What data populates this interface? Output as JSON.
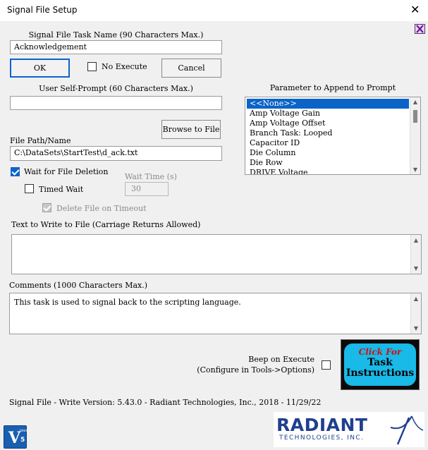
{
  "window": {
    "title": "Signal File Setup",
    "close_glyph": "✕"
  },
  "task_name": {
    "label": "Signal File Task Name (90 Characters Max.)",
    "value": "Acknowledgement"
  },
  "buttons": {
    "ok": "OK",
    "cancel": "Cancel",
    "browse": "Browse to File"
  },
  "no_execute": {
    "label": "No Execute",
    "checked": false
  },
  "self_prompt": {
    "label": "User Self-Prompt (60 Characters Max.)",
    "value": ""
  },
  "parameter": {
    "label": "Parameter to Append to Prompt",
    "items": [
      "<<None>>",
      "Amp Voltage Gain",
      "Amp Voltage Offset",
      "Branch Task: Looped",
      "Capacitor ID",
      "Die Column",
      "Die Row",
      "DRIVE Voltage"
    ],
    "selected": "<<None>>"
  },
  "file_path": {
    "label": "File Path/Name",
    "value": "C:\\DataSets\\StartTest\\d_ack.txt"
  },
  "wait_deletion": {
    "label": "Wait for File Deletion",
    "checked": true
  },
  "timed_wait": {
    "label": "Timed Wait",
    "checked": false
  },
  "wait_time": {
    "label": "Wait Time (s)",
    "value": "30"
  },
  "delete_timeout": {
    "label": "Delete File on Timeout",
    "checked": true,
    "disabled": true
  },
  "text_write": {
    "label": "Text to Write to File (Carriage Returns Allowed)",
    "value": ""
  },
  "comments": {
    "label": "Comments (1000 Characters Max.)",
    "value": "This task is used to signal back to the scripting language."
  },
  "beep": {
    "line1": "Beep on Execute",
    "line2": "(Configure in Tools->Options)",
    "checked": false
  },
  "task_instructions": {
    "line1": "Click For",
    "line2": "Task",
    "line3": "Instructions"
  },
  "footer": {
    "version": "Signal File - Write Version: 5.43.0 - Radiant Technologies, Inc., 2018 - 11/29/22"
  },
  "logo": {
    "name": "RADIANT",
    "sub": "TECHNOLOGIES, INC."
  },
  "vision_badge": {
    "text": "V",
    "small": "ision",
    "num": "5"
  },
  "colors": {
    "accent": "#0a64c8",
    "logo_blue": "#1f3f8f",
    "instructions_bg": "#19b9e8",
    "click_for": "#d01010"
  }
}
